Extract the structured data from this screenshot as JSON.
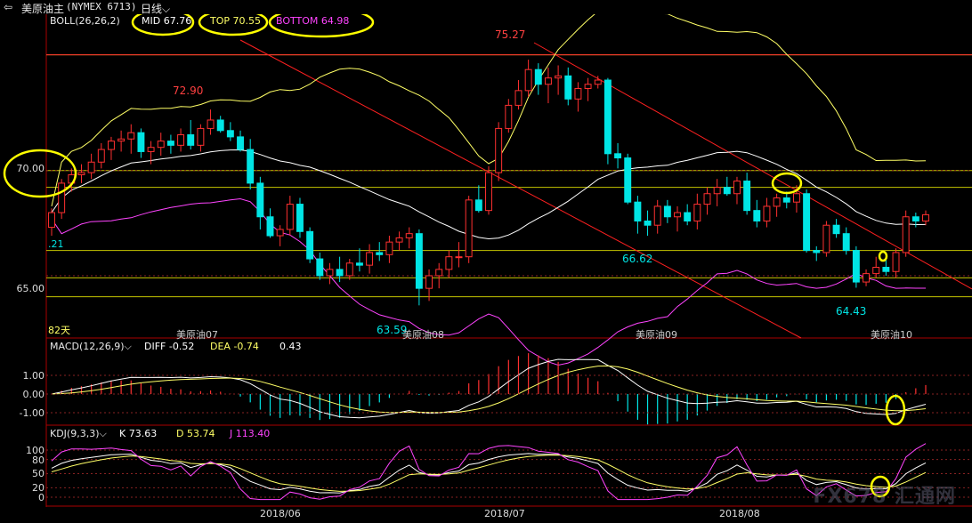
{
  "window": {
    "back_icon": "back-arrow-icon",
    "title": "美原油主",
    "symbol": "(NYMEX 6713)",
    "period": "日线",
    "period_chevron": "chevron-down-icon"
  },
  "boll": {
    "label": "BOLL(26,26,2)",
    "mid": "MID 67.76",
    "top": "TOP 70.55",
    "bottom": "BOTTOM 64.98",
    "colors": {
      "mid": "#ffffff",
      "top": "#ffff66",
      "bottom": "#ff44ff"
    }
  },
  "price_axis": {
    "labels": [
      "70.00",
      "65.00"
    ],
    "left_value": ".21"
  },
  "price_annotations": {
    "high1": "72.90",
    "high2": "75.27",
    "low1": "63.59",
    "low2": "66.62",
    "low3": "64.43"
  },
  "days_label": "82天",
  "contract_labels": [
    "美原油07",
    "美原油08",
    "美原油09",
    "美原油10"
  ],
  "macd": {
    "label": "MACD(12,26,9)",
    "diff": "DIFF -0.52",
    "dea": "DEA -0.74",
    "macd": "0.43",
    "axis": [
      "1.00",
      "0.00",
      "-1.00"
    ]
  },
  "kdj": {
    "label": "KDJ(9,3,3)",
    "k": "K 73.63",
    "d": "D 53.74",
    "j": "J 113.40",
    "axis": [
      "100",
      "80",
      "50",
      "20",
      "0"
    ]
  },
  "x_axis": [
    "2018/06",
    "2018/07",
    "2018/08"
  ],
  "watermark": "FX678 汇通网",
  "colors": {
    "up": "#ff3030",
    "down": "#00e5e5",
    "trend": "#ff2020",
    "hline": "#e8e800",
    "highlight": "#ffff00"
  },
  "chart_data": {
    "type": "candlestick",
    "title": "美原油主(NYMEX 6713) 日线",
    "ylim": [
      62.8,
      76.5
    ],
    "candles": [
      [
        67.3,
        68.2,
        66.9,
        68.0
      ],
      [
        68.0,
        69.6,
        67.7,
        69.4
      ],
      [
        69.4,
        70.1,
        69.0,
        69.8
      ],
      [
        69.8,
        70.3,
        69.4,
        69.9
      ],
      [
        69.9,
        70.8,
        69.6,
        70.4
      ],
      [
        70.4,
        71.3,
        70.1,
        71.0
      ],
      [
        71.0,
        71.6,
        70.5,
        71.4
      ],
      [
        71.4,
        71.9,
        70.9,
        71.5
      ],
      [
        71.5,
        72.2,
        70.8,
        71.8
      ],
      [
        71.8,
        72.0,
        70.6,
        70.9
      ],
      [
        70.9,
        71.4,
        70.3,
        71.1
      ],
      [
        71.1,
        71.8,
        70.7,
        71.4
      ],
      [
        71.4,
        71.7,
        70.8,
        71.2
      ],
      [
        71.2,
        72.0,
        70.9,
        71.7
      ],
      [
        71.7,
        72.4,
        71.0,
        71.2
      ],
      [
        71.2,
        72.2,
        70.9,
        72.0
      ],
      [
        72.0,
        72.9,
        71.7,
        72.4
      ],
      [
        72.4,
        72.6,
        71.8,
        71.9
      ],
      [
        71.9,
        72.3,
        71.4,
        71.6
      ],
      [
        71.6,
        71.9,
        70.9,
        71.0
      ],
      [
        71.0,
        71.5,
        69.1,
        69.4
      ],
      [
        69.4,
        69.7,
        67.2,
        67.8
      ],
      [
        67.8,
        68.2,
        66.8,
        66.9
      ],
      [
        66.9,
        67.4,
        66.4,
        67.2
      ],
      [
        67.2,
        68.8,
        66.9,
        68.4
      ],
      [
        68.4,
        68.7,
        66.8,
        67.1
      ],
      [
        67.1,
        67.3,
        65.6,
        65.8
      ],
      [
        65.8,
        66.1,
        64.8,
        65.0
      ],
      [
        65.0,
        65.6,
        64.6,
        65.3
      ],
      [
        65.3,
        65.9,
        64.7,
        65.0
      ],
      [
        65.0,
        65.8,
        64.8,
        65.6
      ],
      [
        65.6,
        66.3,
        65.2,
        65.5
      ],
      [
        65.5,
        66.5,
        65.1,
        66.1
      ],
      [
        66.1,
        66.6,
        65.7,
        66.0
      ],
      [
        66.0,
        66.9,
        65.6,
        66.6
      ],
      [
        66.6,
        67.1,
        66.2,
        66.8
      ],
      [
        66.8,
        67.3,
        66.3,
        67.0
      ],
      [
        67.0,
        67.2,
        63.59,
        64.4
      ],
      [
        64.4,
        65.3,
        63.8,
        65.0
      ],
      [
        65.0,
        65.6,
        64.4,
        65.3
      ],
      [
        65.3,
        66.2,
        64.9,
        65.9
      ],
      [
        65.9,
        66.6,
        65.4,
        65.9
      ],
      [
        65.9,
        68.8,
        65.6,
        68.6
      ],
      [
        68.6,
        69.3,
        68.0,
        68.1
      ],
      [
        68.1,
        70.2,
        67.9,
        69.9
      ],
      [
        69.9,
        72.3,
        69.5,
        72.0
      ],
      [
        72.0,
        73.4,
        71.8,
        73.1
      ],
      [
        73.1,
        74.3,
        72.9,
        73.8
      ],
      [
        73.8,
        75.27,
        73.5,
        74.8
      ],
      [
        74.8,
        75.1,
        73.6,
        74.1
      ],
      [
        74.1,
        74.9,
        73.2,
        74.4
      ],
      [
        74.4,
        75.0,
        73.6,
        74.5
      ],
      [
        74.5,
        74.9,
        73.1,
        73.4
      ],
      [
        73.4,
        74.2,
        72.8,
        73.9
      ],
      [
        73.9,
        74.4,
        73.3,
        74.1
      ],
      [
        74.1,
        74.5,
        73.9,
        74.3
      ],
      [
        74.3,
        74.4,
        70.3,
        70.8
      ],
      [
        70.8,
        71.3,
        70.1,
        70.6
      ],
      [
        70.6,
        70.8,
        68.4,
        68.5
      ],
      [
        68.5,
        68.8,
        67.0,
        67.6
      ],
      [
        67.6,
        68.1,
        66.9,
        67.4
      ],
      [
        67.4,
        68.6,
        67.0,
        68.3
      ],
      [
        68.3,
        68.6,
        67.5,
        67.8
      ],
      [
        67.8,
        68.3,
        67.1,
        68.0
      ],
      [
        68.0,
        68.4,
        67.4,
        67.6
      ],
      [
        67.6,
        68.9,
        67.2,
        68.4
      ],
      [
        68.4,
        69.2,
        67.9,
        68.9
      ],
      [
        68.9,
        69.6,
        68.3,
        69.2
      ],
      [
        69.2,
        69.7,
        68.8,
        68.9
      ],
      [
        68.9,
        69.7,
        68.4,
        69.5
      ],
      [
        69.5,
        69.9,
        67.9,
        68.1
      ],
      [
        68.1,
        68.6,
        67.3,
        67.6
      ],
      [
        67.6,
        68.7,
        67.3,
        68.3
      ],
      [
        68.3,
        68.9,
        67.8,
        68.7
      ],
      [
        68.7,
        69.0,
        68.2,
        68.5
      ],
      [
        68.5,
        69.3,
        68.0,
        68.9
      ],
      [
        68.9,
        69.1,
        66.1,
        66.2
      ],
      [
        66.2,
        66.4,
        65.7,
        66.1
      ],
      [
        66.1,
        67.6,
        65.9,
        67.4
      ],
      [
        67.4,
        67.7,
        66.8,
        67.0
      ],
      [
        67.0,
        67.3,
        66.0,
        66.2
      ],
      [
        66.2,
        66.4,
        64.43,
        64.7
      ],
      [
        64.7,
        65.3,
        64.5,
        65.1
      ],
      [
        65.1,
        65.9,
        64.9,
        65.4
      ],
      [
        65.4,
        65.8,
        65.0,
        65.2
      ],
      [
        65.2,
        66.3,
        64.9,
        66.1
      ],
      [
        66.1,
        68.1,
        65.9,
        67.8
      ],
      [
        67.8,
        68.0,
        67.3,
        67.6
      ],
      [
        67.6,
        68.1,
        67.4,
        67.9
      ]
    ],
    "indicators": {
      "boll_mid": 67.76,
      "boll_top": 70.55,
      "boll_bottom": 64.98,
      "macd_diff": -0.52,
      "macd_dea": -0.74,
      "macd": 0.43,
      "kdj_k": 73.63,
      "kdj_d": 53.74,
      "kdj_j": 113.4
    }
  }
}
